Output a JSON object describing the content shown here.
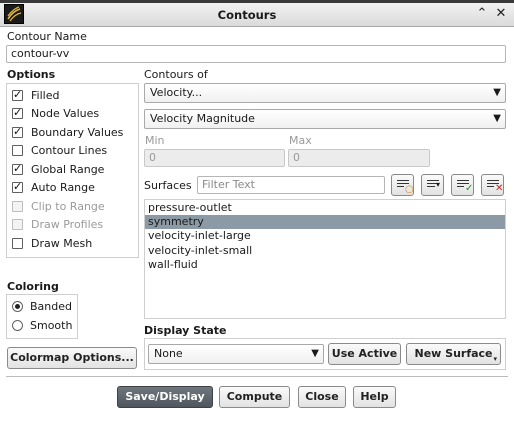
{
  "window": {
    "title": "Contours"
  },
  "contour_name": {
    "label": "Contour Name",
    "value": "contour-vv"
  },
  "options": {
    "label": "Options",
    "items": [
      {
        "label": "Filled",
        "checked": true,
        "enabled": true
      },
      {
        "label": "Node Values",
        "checked": true,
        "enabled": true
      },
      {
        "label": "Boundary Values",
        "checked": true,
        "enabled": true
      },
      {
        "label": "Contour Lines",
        "checked": false,
        "enabled": true
      },
      {
        "label": "Global Range",
        "checked": true,
        "enabled": true
      },
      {
        "label": "Auto Range",
        "checked": true,
        "enabled": true
      },
      {
        "label": "Clip to Range",
        "checked": false,
        "enabled": false
      },
      {
        "label": "Draw Profiles",
        "checked": false,
        "enabled": false
      },
      {
        "label": "Draw Mesh",
        "checked": false,
        "enabled": true
      }
    ]
  },
  "coloring": {
    "label": "Coloring",
    "items": [
      {
        "label": "Banded",
        "selected": true
      },
      {
        "label": "Smooth",
        "selected": false
      }
    ]
  },
  "colormap_button": "Colormap Options...",
  "contours_of": {
    "label": "Contours of",
    "category": "Velocity...",
    "quantity": "Velocity Magnitude"
  },
  "range": {
    "min_label": "Min",
    "min_value": "0",
    "max_label": "Max",
    "max_value": "0"
  },
  "surfaces": {
    "label": "Surfaces",
    "filter_placeholder": "Filter Text",
    "items": [
      "pressure-outlet",
      "symmetry",
      "velocity-inlet-large",
      "velocity-inlet-small",
      "wall-fluid"
    ],
    "selected_index": 1
  },
  "display_state": {
    "label": "Display State",
    "value": "None",
    "use_active": "Use Active",
    "new_surface": "New Surface"
  },
  "footer": {
    "save_display": "Save/Display",
    "compute": "Compute",
    "close": "Close",
    "help": "Help"
  },
  "colors": {
    "selection": "#8c9aa6",
    "primary_button": "#5c636a"
  }
}
